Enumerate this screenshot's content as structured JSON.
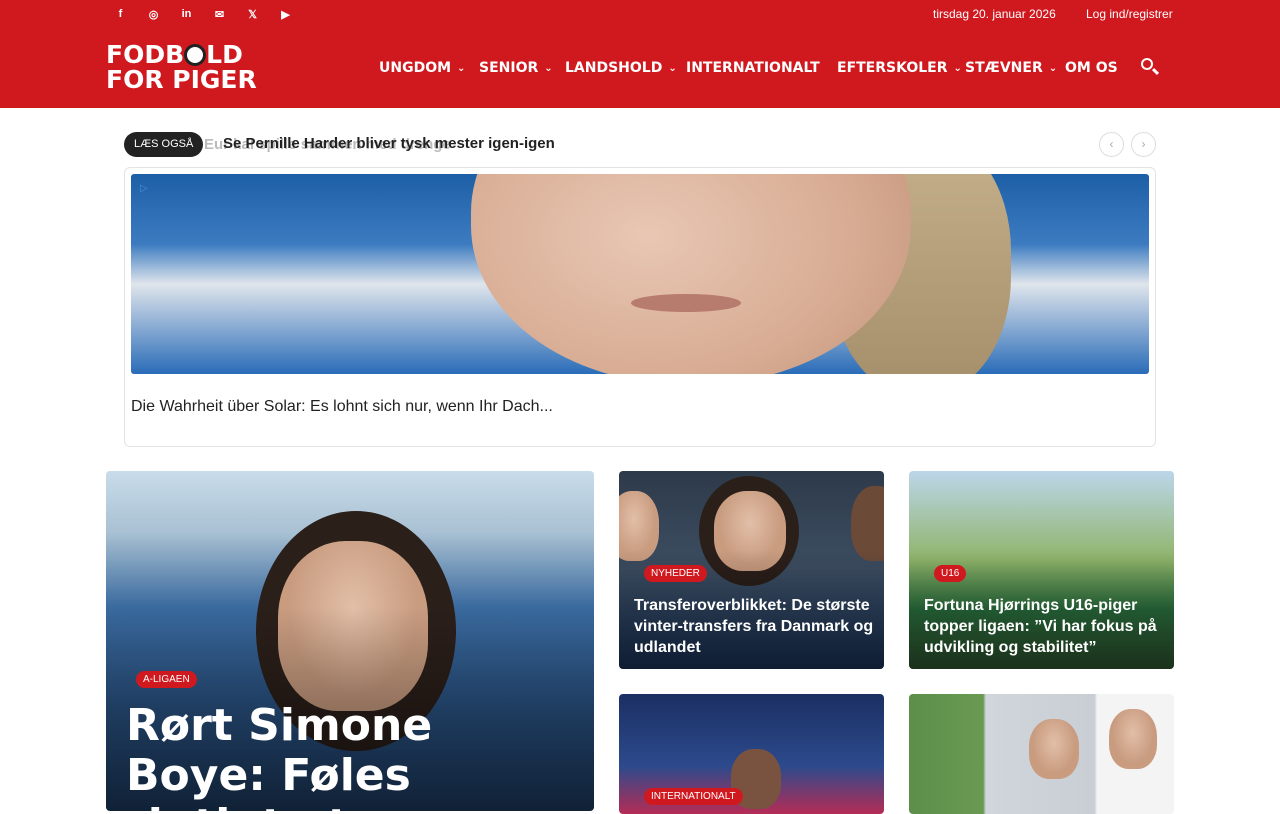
{
  "topbar": {
    "social_icons": [
      "facebook-icon",
      "instagram-icon",
      "linkedin-icon",
      "mail-icon",
      "x-icon",
      "youtube-icon"
    ],
    "social_glyphs": [
      "f",
      "◎",
      "in",
      "✉",
      "𝕏",
      "▶"
    ],
    "date": "tirsdag 20. januar 2026",
    "login": "Log ind/registrer"
  },
  "logo": {
    "line1_a": "FODB",
    "line1_b": "LD",
    "line2": "FOR PIGER"
  },
  "nav": {
    "items": [
      {
        "label": "UNGDOM",
        "chevron": "⌄"
      },
      {
        "label": "SENIOR",
        "chevron": "⌄"
      },
      {
        "label": "LANDSHOLD",
        "chevron": "⌄"
      },
      {
        "label": "INTERNATIONALT",
        "chevron": ""
      },
      {
        "label": "EFTERSKOLER",
        "chevron": "⌄"
      },
      {
        "label": "STÆVNER",
        "chevron": "⌄"
      },
      {
        "label": "OM OS",
        "chevron": ""
      }
    ]
  },
  "ticker": {
    "badge": "LÆS OGSÅ",
    "ghost_text": "Eur                                                              kal spille sammen med drenge",
    "headline": "Se Pernille Harder bliver tysk mester igen-igen",
    "prev": "‹",
    "next": "›"
  },
  "ad": {
    "icon": "▷",
    "text": "Die Wahrheit über Solar: Es lohnt sich nur, wenn Ihr Dach..."
  },
  "articles": [
    {
      "tag": "A-LIGAEN",
      "title": "Rørt Simone Boye: Føles rigtigt at"
    },
    {
      "tag": "NYHEDER",
      "title": "Transferoverblikket: De største vinter-transfers fra Danmark og udlandet"
    },
    {
      "tag": "U16",
      "title": "Fortuna Hjørrings U16-piger topper ligaen: ”Vi har fokus på udvikling og stabilitet”"
    },
    {
      "tag": "INTERNATIONALT",
      "title": ""
    },
    {
      "tag": "",
      "title": ""
    }
  ],
  "colors": {
    "brand_red": "#d0191f",
    "dark": "#222222"
  }
}
